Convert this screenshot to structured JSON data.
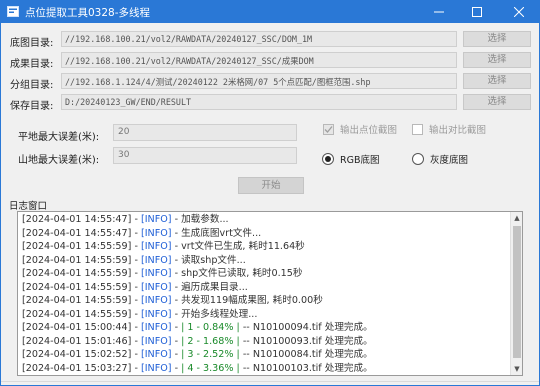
{
  "window": {
    "title": "点位提取工具0328-多线程",
    "minimize": "—",
    "maximize": "☐",
    "close": "✕"
  },
  "paths": [
    {
      "label": "底图目录:",
      "value": "//192.168.100.21/vol2/RAWDATA/20240127_SSC/DOM_1M",
      "button": "选择"
    },
    {
      "label": "成果目录:",
      "value": "//192.168.100.21/vol2/RAWDATA/20240127_SSC/成果DOM",
      "button": "选择"
    },
    {
      "label": "分组目录:",
      "value": "//192.168.1.124/4/测试/20240122 2米格网/07 5个点匹配/图框范围.shp",
      "button": "选择"
    },
    {
      "label": "保存目录:",
      "value": "D:/20240123_GW/END/RESULT",
      "button": "选择"
    }
  ],
  "params": {
    "flat_label": "平地最大误差(米):",
    "flat_value": "20",
    "mountain_label": "山地最大误差(米):",
    "mountain_value": "30"
  },
  "options": {
    "output_points_map": {
      "label": "输出点位截图",
      "checked": true
    },
    "output_compare_map": {
      "label": "输出对比截图",
      "checked": false
    },
    "rgb_basemap": {
      "label": "RGB底图",
      "selected": true
    },
    "gray_basemap": {
      "label": "灰度底图",
      "selected": false
    }
  },
  "start_button": "开始",
  "log": {
    "title": "日志窗口",
    "lines": [
      {
        "ts": "[2024-04-01 14:55:47]",
        "level": "[INFO]",
        "progress": "",
        "msg": " - 加载参数..."
      },
      {
        "ts": "[2024-04-01 14:55:47]",
        "level": "[INFO]",
        "progress": "",
        "msg": " - 生成底图vrt文件..."
      },
      {
        "ts": "[2024-04-01 14:55:59]",
        "level": "[INFO]",
        "progress": "",
        "msg": " - vrt文件已生成, 耗时11.64秒"
      },
      {
        "ts": "[2024-04-01 14:55:59]",
        "level": "[INFO]",
        "progress": "",
        "msg": " - 读取shp文件..."
      },
      {
        "ts": "[2024-04-01 14:55:59]",
        "level": "[INFO]",
        "progress": "",
        "msg": " - shp文件已读取, 耗时0.15秒"
      },
      {
        "ts": "[2024-04-01 14:55:59]",
        "level": "[INFO]",
        "progress": "",
        "msg": " - 遍历成果目录..."
      },
      {
        "ts": "[2024-04-01 14:55:59]",
        "level": "[INFO]",
        "progress": "",
        "msg": " - 共发现119幅成果图, 耗时0.00秒"
      },
      {
        "ts": "[2024-04-01 14:55:59]",
        "level": "[INFO]",
        "progress": "",
        "msg": " - 开始多线程处理..."
      },
      {
        "ts": "[2024-04-01 15:00:44]",
        "level": "[INFO]",
        "progress": "| 1 - 0.84% |",
        "msg": " -- N10100094.tif 处理完成。"
      },
      {
        "ts": "[2024-04-01 15:01:46]",
        "level": "[INFO]",
        "progress": "| 2 - 1.68% |",
        "msg": " -- N10100093.tif 处理完成。"
      },
      {
        "ts": "[2024-04-01 15:02:52]",
        "level": "[INFO]",
        "progress": "| 3 - 2.52% |",
        "msg": " -- N10100084.tif 处理完成。"
      },
      {
        "ts": "[2024-04-01 15:03:27]",
        "level": "[INFO]",
        "progress": "| 4 - 3.36% |",
        "msg": " -- N10100103.tif 处理完成。"
      }
    ]
  },
  "colors": {
    "titlebar": "#2a78d6",
    "info_level": "#1f5fd6",
    "progress": "#1a8a2a"
  }
}
